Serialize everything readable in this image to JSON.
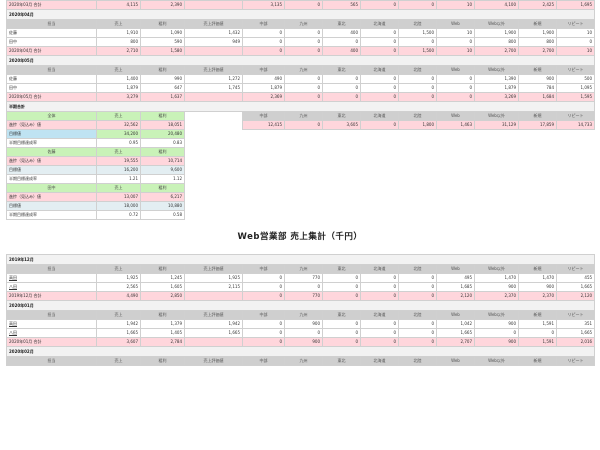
{
  "headers": [
    "担当",
    "売上",
    "粗利",
    "売上評価値",
    "中部",
    "九州",
    "東北",
    "北海道",
    "北陸",
    "Web",
    "Web以外",
    "新規",
    "リピート"
  ],
  "tableA": {
    "top_subtotal": {
      "label": "2020年03月 合計",
      "values": [
        "4,115",
        "2,390",
        "",
        "3,135",
        "0",
        "565",
        "0",
        "0",
        "10",
        "4,100",
        "2,425",
        "1,695"
      ]
    },
    "apr": {
      "section": "2020年04月",
      "rows": [
        {
          "name": "佐藤",
          "values": [
            "1,910",
            "1,090",
            "1,432",
            "0",
            "0",
            "400",
            "0",
            "1,500",
            "10",
            "1,900",
            "1,900",
            "10"
          ]
        },
        {
          "name": "田中",
          "values": [
            "800",
            "590",
            "949",
            "0",
            "0",
            "0",
            "0",
            "0",
            "0",
            "800",
            "800",
            "0"
          ]
        }
      ],
      "subtotal": {
        "label": "2020年04月 合計",
        "values": [
          "2,710",
          "1,580",
          "",
          "0",
          "0",
          "400",
          "0",
          "1,500",
          "10",
          "2,700",
          "2,700",
          "10"
        ]
      }
    },
    "may": {
      "section": "2020年05月",
      "rows": [
        {
          "name": "佐藤",
          "values": [
            "1,400",
            "990",
            "1,272",
            "490",
            "0",
            "0",
            "0",
            "0",
            "0",
            "1,390",
            "900",
            "500"
          ]
        },
        {
          "name": "田中",
          "values": [
            "1,879",
            "647",
            "1,745",
            "1,879",
            "0",
            "0",
            "0",
            "0",
            "0",
            "1,879",
            "784",
            "1,095"
          ]
        }
      ],
      "subtotal": {
        "label": "2020年05月 合計",
        "values": [
          "3,279",
          "1,637",
          "",
          "2,369",
          "0",
          "0",
          "0",
          "0",
          "0",
          "3,269",
          "1,684",
          "1,595"
        ]
      }
    }
  },
  "half": {
    "section": "半期合計",
    "head": [
      "全体",
      "売上",
      "粗利",
      "",
      "中部",
      "九州",
      "東北",
      "北海道",
      "北陸",
      "Web",
      "Web以外",
      "新規",
      "リピート"
    ],
    "actual": {
      "label": "進捗（見込み）値",
      "values": [
        "32,562",
        "18,051",
        "",
        "12,415",
        "0",
        "3,605",
        "0",
        "1,800",
        "1,463",
        "31,129",
        "17,859",
        "14,733"
      ]
    },
    "target": {
      "label": "目標値",
      "values": [
        "34,200",
        "20,480"
      ]
    },
    "rate": {
      "label": "半期目標達成率",
      "values": [
        "0.95",
        "0.83"
      ]
    },
    "sato": {
      "head": [
        "佐藤",
        "売上",
        "粗利"
      ],
      "actual": {
        "label": "進捗（見込み）値",
        "values": [
          "19,555",
          "10,714"
        ]
      },
      "target": {
        "label": "目標値",
        "values": [
          "16,200",
          "9,600"
        ]
      },
      "rate": {
        "label": "半期目標達成率",
        "values": [
          "1.21",
          "1.12"
        ]
      }
    },
    "tanaka": {
      "head": [
        "田中",
        "売上",
        "粗利"
      ],
      "actual": {
        "label": "進捗（見込み）値",
        "values": [
          "13,007",
          "6,217"
        ]
      },
      "target": {
        "label": "目標値",
        "values": [
          "18,000",
          "10,880"
        ]
      },
      "rate": {
        "label": "半期目標達成率",
        "values": [
          "0.72",
          "0.58"
        ]
      }
    }
  },
  "title2": "Web営業部 売上集計（千円）",
  "tableB": {
    "dec": {
      "section": "2019年12月",
      "rows": [
        {
          "name": "高田",
          "values": [
            "1,925",
            "1,245",
            "1,925",
            "0",
            "770",
            "0",
            "0",
            "0",
            "495",
            "1,470",
            "1,470",
            "455"
          ]
        },
        {
          "name": "八田",
          "values": [
            "2,565",
            "1,605",
            "2,115",
            "0",
            "0",
            "0",
            "0",
            "0",
            "1,685",
            "900",
            "900",
            "1,665"
          ]
        }
      ],
      "subtotal": {
        "label": "2019年12月 合計",
        "values": [
          "4,490",
          "2,850",
          "",
          "0",
          "770",
          "0",
          "0",
          "0",
          "2,120",
          "2,370",
          "2,370",
          "2,120"
        ]
      }
    },
    "jan": {
      "section": "2020年01月",
      "rows": [
        {
          "name": "高田",
          "values": [
            "1,942",
            "1,379",
            "1,942",
            "0",
            "900",
            "0",
            "0",
            "0",
            "1,042",
            "900",
            "1,591",
            "351"
          ]
        },
        {
          "name": "八田",
          "values": [
            "1,665",
            "1,405",
            "1,665",
            "0",
            "0",
            "0",
            "0",
            "0",
            "1,665",
            "0",
            "0",
            "1,665"
          ]
        }
      ],
      "subtotal": {
        "label": "2020年01月 合計",
        "values": [
          "3,607",
          "2,784",
          "",
          "0",
          "900",
          "0",
          "0",
          "0",
          "2,707",
          "900",
          "1,591",
          "2,016"
        ]
      }
    },
    "feb": {
      "section": "2020年02月"
    }
  }
}
